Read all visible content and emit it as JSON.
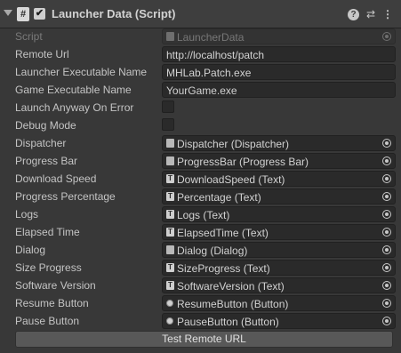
{
  "header": {
    "icon": "#",
    "enabled_check": "✔",
    "title": "Launcher Data (Script)",
    "help": "?",
    "preset": "⇄",
    "menu": "⋮"
  },
  "fields": {
    "script": {
      "label": "Script",
      "value": "LauncherData"
    },
    "remote_url": {
      "label": "Remote Url",
      "value": "http://localhost/patch"
    },
    "launcher_exe": {
      "label": "Launcher Executable Name",
      "value": "MHLab.Patch.exe"
    },
    "game_exe": {
      "label": "Game Executable Name",
      "value": "YourGame.exe"
    },
    "launch_anyway": {
      "label": "Launch Anyway On Error"
    },
    "debug_mode": {
      "label": "Debug Mode"
    },
    "dispatcher": {
      "label": "Dispatcher",
      "value": "Dispatcher (Dispatcher)"
    },
    "progress_bar": {
      "label": "Progress Bar",
      "value": "ProgressBar (Progress Bar)"
    },
    "download_speed": {
      "label": "Download Speed",
      "value": "DownloadSpeed (Text)"
    },
    "progress_percentage": {
      "label": "Progress Percentage",
      "value": "Percentage (Text)"
    },
    "logs": {
      "label": "Logs",
      "value": "Logs (Text)"
    },
    "elapsed_time": {
      "label": "Elapsed Time",
      "value": "ElapsedTime (Text)"
    },
    "dialog": {
      "label": "Dialog",
      "value": "Dialog (Dialog)"
    },
    "size_progress": {
      "label": "Size Progress",
      "value": "SizeProgress (Text)"
    },
    "software_version": {
      "label": "Software Version",
      "value": "SoftwareVersion (Text)"
    },
    "resume_button": {
      "label": "Resume Button",
      "value": "ResumeButton (Button)"
    },
    "pause_button": {
      "label": "Pause Button",
      "value": "PauseButton (Button)"
    }
  },
  "icons": {
    "text_type": "T"
  },
  "test_button": "Test Remote URL"
}
